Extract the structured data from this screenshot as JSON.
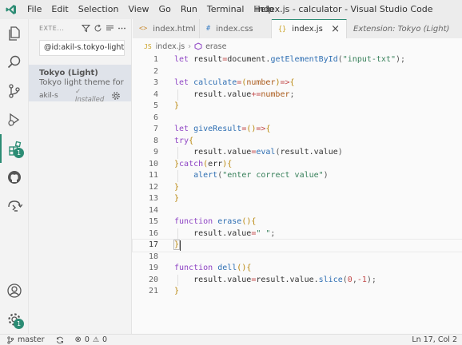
{
  "menu": [
    "File",
    "Edit",
    "Selection",
    "View",
    "Go",
    "Run",
    "Terminal",
    "Help"
  ],
  "window_title": "index.js - calculator - Visual Studio Code",
  "sidebar": {
    "title": "EXTE...",
    "search_value": "@id:akil-s.tokyo-light",
    "extension": {
      "name": "Tokyo (Light)",
      "description": "Tokyo light theme for ...",
      "author": "akil-s",
      "installed": "✓ Installed"
    }
  },
  "activity_badges": {
    "extensions": "1",
    "manage": "1"
  },
  "tabs": [
    {
      "icon": "<>",
      "label": "index.html"
    },
    {
      "icon": "#",
      "label": "index.css"
    },
    {
      "icon": "{}",
      "label": "index.js"
    },
    {
      "icon": "",
      "label": "Extension: Tokyo (Light)"
    }
  ],
  "breadcrumb": {
    "file_icon": "JS",
    "file": "index.js",
    "symbol": "erase"
  },
  "editor": {
    "line_numbers": [
      "1",
      "2",
      "3",
      "4",
      "5",
      "6",
      "7",
      "8",
      "9",
      "10",
      "11",
      "12",
      "13",
      "14",
      "15",
      "16",
      "17",
      "18",
      "19",
      "20",
      "21"
    ]
  },
  "status": {
    "branch": "master",
    "errors": "0",
    "warnings": "0",
    "position": "Ln 17, Col 2"
  },
  "colors": {
    "accent": "#2c8c74",
    "keyword": "#8e44c4",
    "function": "#2f6fb3",
    "string": "#37805a"
  }
}
